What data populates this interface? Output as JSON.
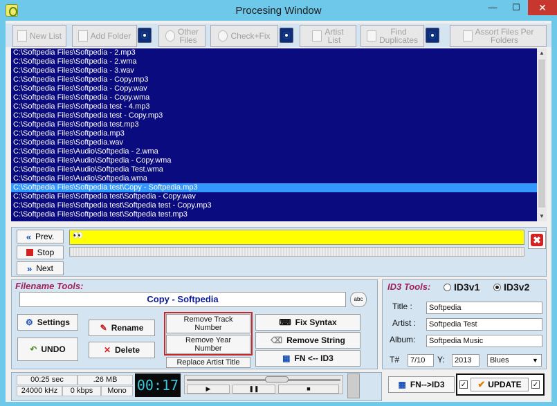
{
  "window": {
    "title": "Procesing Window",
    "min": "—",
    "max": "☐",
    "close": "✕"
  },
  "toolbar": {
    "new_list": "New List",
    "add_folder": "Add Folder",
    "other_files": [
      "Other",
      "Files"
    ],
    "check_fix": "Check+Fix",
    "artist_list": [
      "Artist",
      "List"
    ],
    "find_duplicates": [
      "Find",
      "Duplicates"
    ],
    "assort_files": [
      "Assort Files Per",
      "Folders"
    ]
  },
  "files": [
    "C:\\Softpedia Files\\Softpedia - 2.mp3",
    "C:\\Softpedia Files\\Softpedia - 2.wma",
    "C:\\Softpedia Files\\Softpedia - 3.wav",
    "C:\\Softpedia Files\\Softpedia - Copy.mp3",
    "C:\\Softpedia Files\\Softpedia - Copy.wav",
    "C:\\Softpedia Files\\Softpedia - Copy.wma",
    "C:\\Softpedia Files\\Softpedia test - 4.mp3",
    "C:\\Softpedia Files\\Softpedia test - Copy.mp3",
    "C:\\Softpedia Files\\Softpedia test.mp3",
    "C:\\Softpedia Files\\Softpedia.mp3",
    "C:\\Softpedia Files\\Softpedia.wav",
    "C:\\Softpedia Files\\Audio\\Softpedia - 2.wma",
    "C:\\Softpedia Files\\Audio\\Softpedia - Copy.wma",
    "C:\\Softpedia Files\\Audio\\Softpedia Test.wma",
    "C:\\Softpedia Files\\Audio\\Softpedia.wma",
    "C:\\Softpedia Files\\Softpedia test\\Copy - Softpedia.mp3",
    "C:\\Softpedia Files\\Softpedia test\\Softpedia - Copy.wav",
    "C:\\Softpedia Files\\Softpedia test\\Softpedia test - Copy.mp3",
    "C:\\Softpedia Files\\Softpedia test\\Softpedia test.mp3"
  ],
  "selected_index": 15,
  "nav": {
    "prev": "Prev.",
    "stop": "Stop",
    "next": "Next"
  },
  "progress_text": "👀",
  "close_x": "✖",
  "filename_tools": {
    "label": "Filename Tools:",
    "filename": "Copy - Softpedia",
    "abc": "abc",
    "settings": "Settings",
    "undo": "UNDO",
    "rename": "Rename",
    "delete": "Delete",
    "remove_track": [
      "Remove Track",
      "Number"
    ],
    "remove_year": [
      "Remove Year",
      "Number"
    ],
    "replace_artist": "Replace Artist Title",
    "fix_syntax": "Fix Syntax",
    "remove_string": "Remove String",
    "fn_from_id3": "FN <-- ID3"
  },
  "id3_tools": {
    "label": "ID3 Tools:",
    "v1": "ID3v1",
    "v2": "ID3v2",
    "title_label": "Title :",
    "title": "Softpedia",
    "artist_label": "Artist :",
    "artist": "Softpedia Test",
    "album_label": "Album:",
    "album": "Softpedia Music",
    "track_label": "T#",
    "track": "7/10",
    "year_label": "Y:",
    "year": "2013",
    "genre": "Blues",
    "fn_to_id3": "FN-->ID3",
    "update": "UPDATE"
  },
  "status": {
    "duration": "00:25 sec",
    "size": ".26 MB",
    "freq": "24000 kHz",
    "bitrate": "0 kbps",
    "channels": "Mono",
    "time": "00:17"
  },
  "player": {
    "play": "▶",
    "pause": "❚❚",
    "stop": "■"
  }
}
